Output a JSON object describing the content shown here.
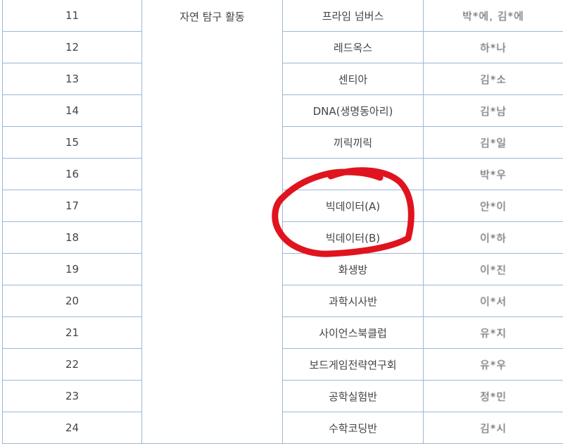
{
  "category": "자연 탐구 활동",
  "rows": [
    {
      "no": "11",
      "club": "프라임 넘버스",
      "advisor": "박*에, 김*에"
    },
    {
      "no": "12",
      "club": "레드옥스",
      "advisor": "하*나"
    },
    {
      "no": "13",
      "club": "센티아",
      "advisor": "김*소"
    },
    {
      "no": "14",
      "club": "DNA(생명동아리)",
      "advisor": "김*남"
    },
    {
      "no": "15",
      "club": "끼릭끼릭",
      "advisor": "김*일"
    },
    {
      "no": "16",
      "club": "",
      "advisor": "박*우"
    },
    {
      "no": "17",
      "club": "빅데이터(A)",
      "advisor": "안*이"
    },
    {
      "no": "18",
      "club": "빅데이터(B)",
      "advisor": "이*하"
    },
    {
      "no": "19",
      "club": "화생방",
      "advisor": "이*진"
    },
    {
      "no": "20",
      "club": "과학시사반",
      "advisor": "이*서"
    },
    {
      "no": "21",
      "club": "사이언스북클럽",
      "advisor": "유*지"
    },
    {
      "no": "22",
      "club": "보드게임전략연구회",
      "advisor": "유*우"
    },
    {
      "no": "23",
      "club": "공학실험반",
      "advisor": "정*민"
    },
    {
      "no": "24",
      "club": "수학코딩반",
      "advisor": "김*시"
    }
  ],
  "annotation": {
    "shape": "circle",
    "color": "#e0141e",
    "encloses_rows": [
      "17",
      "18"
    ]
  }
}
